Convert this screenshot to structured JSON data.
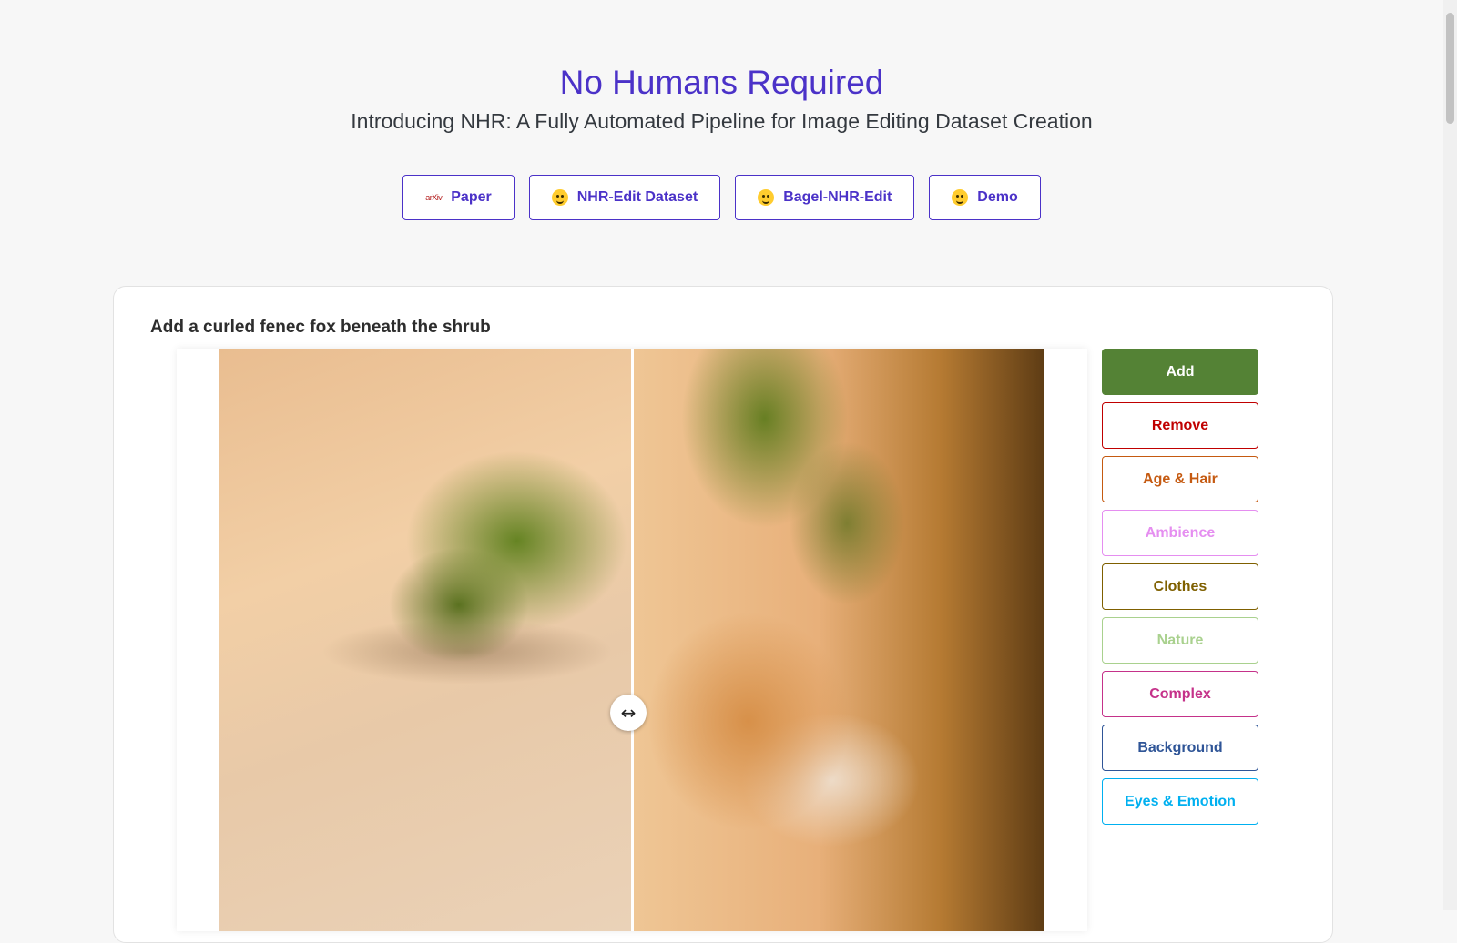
{
  "header": {
    "title": "No Humans Required",
    "subtitle": "Introducing NHR: A Fully Automated Pipeline for Image Editing Dataset Creation"
  },
  "links": [
    {
      "label": "Paper",
      "icon": "arxiv-icon"
    },
    {
      "label": "NHR-Edit Dataset",
      "icon": "hugging-face-icon"
    },
    {
      "label": "Bagel-NHR-Edit",
      "icon": "hugging-face-icon"
    },
    {
      "label": "Demo",
      "icon": "hugging-face-icon"
    }
  ],
  "arxiv_icon_text": "arXiv",
  "example": {
    "caption": "Add a curled fenec fox beneath the shrub",
    "slider_handle_icon": "↔",
    "slider_position": 0.5
  },
  "categories": [
    {
      "label": "Add",
      "color": "#548235",
      "active": true
    },
    {
      "label": "Remove",
      "color": "#c00000",
      "active": false
    },
    {
      "label": "Age & Hair",
      "color": "#c55a11",
      "active": false
    },
    {
      "label": "Ambience",
      "color": "#e58ef0",
      "active": false
    },
    {
      "label": "Clothes",
      "color": "#7f6000",
      "active": false
    },
    {
      "label": "Nature",
      "color": "#a9d18e",
      "active": false
    },
    {
      "label": "Complex",
      "color": "#c5328a",
      "active": false
    },
    {
      "label": "Background",
      "color": "#2f5597",
      "active": false
    },
    {
      "label": "Eyes & Emotion",
      "color": "#00b0f0",
      "active": false
    }
  ]
}
